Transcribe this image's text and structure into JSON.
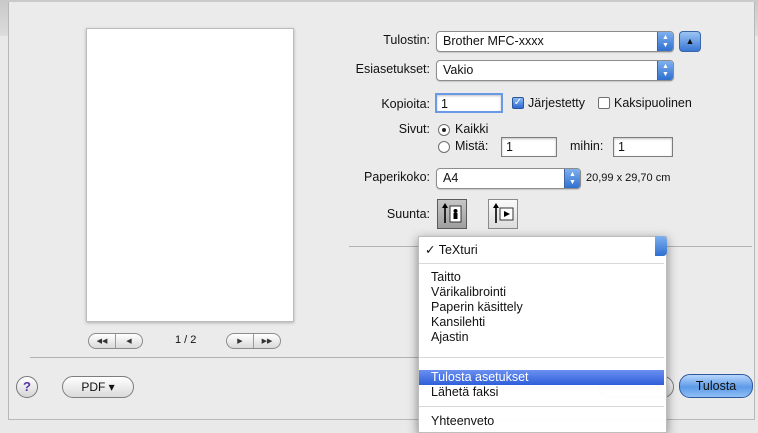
{
  "printer": {
    "label": "Tulostin:",
    "value": "Brother MFC-xxxx"
  },
  "presets": {
    "label": "Esiasetukset:",
    "value": "Vakio"
  },
  "copies": {
    "label": "Kopioita:",
    "value": "1",
    "collated_label": "Järjestetty",
    "collated": true,
    "duplex_label": "Kaksipuolinen",
    "duplex": false
  },
  "pages": {
    "label": "Sivut:",
    "all_label": "Kaikki",
    "from_label": "Mistä:",
    "from_value": "1",
    "to_label": "mihin:",
    "to_value": "1"
  },
  "paper": {
    "label": "Paperikoko:",
    "value": "A4",
    "dimensions": "20,99 x 29,70 cm"
  },
  "orientation": {
    "label": "Suunta:"
  },
  "pager": {
    "page_text": "1 / 2"
  },
  "menu": {
    "checked_mark": "✓",
    "items_top": [
      "TeXturi"
    ],
    "items_group2": [
      "Taitto",
      "Värikalibrointi",
      "Paperin käsittely",
      "Kansilehti",
      "Ajastin"
    ],
    "items_group3": [
      "Tulosta asetukset",
      "Lähetä faksi"
    ],
    "items_group4": [
      "Yhteenveto"
    ],
    "highlighted": "Tulosta asetukset"
  },
  "footer": {
    "help_label": "?",
    "pdf_label": "PDF ▾",
    "print_label": "Tulosta"
  }
}
